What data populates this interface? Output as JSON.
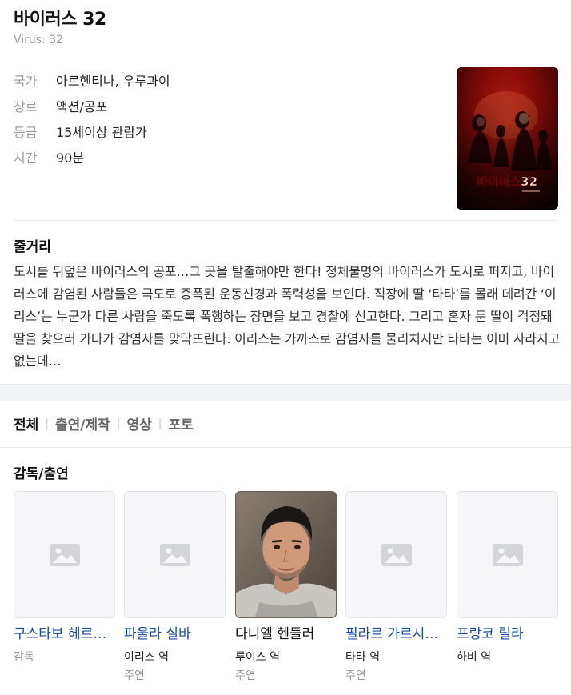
{
  "movie": {
    "title": "바이러스 32",
    "original_title": "Virus: 32"
  },
  "info": [
    {
      "label": "국가",
      "value": "아르헨티나, 우루과이"
    },
    {
      "label": "장르",
      "value": "액션/공포"
    },
    {
      "label": "등급",
      "value": "15세이상 관람가"
    },
    {
      "label": "시간",
      "value": "90분"
    }
  ],
  "poster": {
    "title_text": "바이러스32"
  },
  "synopsis": {
    "heading": "줄거리",
    "text": "도시를 뒤덮은 바이러스의 공포…그 곳을 탈출해야만 한다! 정체불명의 바이러스가 도시로 퍼지고, 바이러스에 감염된 사람들은 극도로 증폭된 운동신경과 폭력성을 보인다. 직장에 딸 ‘타타’를 몰래 데려간 ‘이리스’는 누군가 다른 사람을 죽도록 폭행하는 장면을 보고 경찰에 신고한다. 그리고 혼자 둔 딸이 걱정돼 딸을 찾으러 가다가 감염자를 맞닥뜨린다. 이리스는 가까스로 감염자를 물리치지만 타타는 이미 사라지고 없는데…"
  },
  "tabs": [
    {
      "label": "전체",
      "active": true
    },
    {
      "label": "출연/제작",
      "active": false
    },
    {
      "label": "영상",
      "active": false
    },
    {
      "label": "포토",
      "active": false
    }
  ],
  "cast": {
    "heading": "감독/출연",
    "people": [
      {
        "name": "구스타보 헤르…",
        "role": "",
        "type": "감독",
        "photo": "placeholder-icon",
        "link": true
      },
      {
        "name": "파울라 실바",
        "role": "이리스 역",
        "type": "주연",
        "photo": "placeholder-icon",
        "link": true
      },
      {
        "name": "다니엘 헨들러",
        "role": "루이스 역",
        "type": "주연",
        "photo": "portrait",
        "link": false
      },
      {
        "name": "필라르 가르시…",
        "role": "타타 역",
        "type": "주연",
        "photo": "placeholder-icon",
        "link": true
      },
      {
        "name": "프랑코 릴라",
        "role": "하비 역",
        "type": "",
        "photo": "placeholder-icon",
        "link": true
      }
    ]
  },
  "colors": {
    "link": "#1a4aa8",
    "muted": "#999999",
    "poster_red": "#8b0a0a"
  }
}
